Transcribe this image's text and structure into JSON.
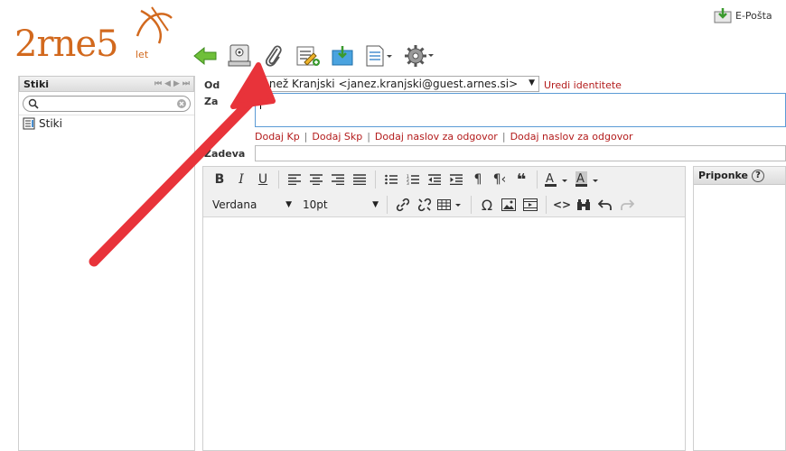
{
  "header": {
    "logo_text": "2rne5",
    "logo_sub": "let",
    "eposta_label": "E-Pošta"
  },
  "toolbar": {
    "buttons": [
      "back-icon",
      "scanner-icon",
      "attachment-icon",
      "signature-icon",
      "save-to-folder-icon",
      "document-options-icon",
      "settings-icon"
    ]
  },
  "contacts": {
    "header": "Stiki",
    "search_placeholder": "",
    "items": [
      {
        "label": "Stiki"
      }
    ]
  },
  "compose": {
    "from_label": "Od",
    "from_value": "Janež Kranjski <janez.kranjski@guest.arnes.si>",
    "edit_identities": "Uredi identitete",
    "to_label": "Za",
    "to_value": "",
    "links": [
      "Dodaj Kp",
      "Dodaj Skp",
      "Dodaj naslov za odgovor",
      "Dodaj naslov za odgovor"
    ],
    "link_separator": "|",
    "subject_label": "Zadeva",
    "subject_value": ""
  },
  "editor": {
    "font_family": "Verdana",
    "font_size": "10pt"
  },
  "attachments": {
    "header": "Priponke",
    "help": "?"
  },
  "colors": {
    "accent": "#d2691e",
    "link": "#b31b1b",
    "annotation_arrow": "#e8333a"
  }
}
